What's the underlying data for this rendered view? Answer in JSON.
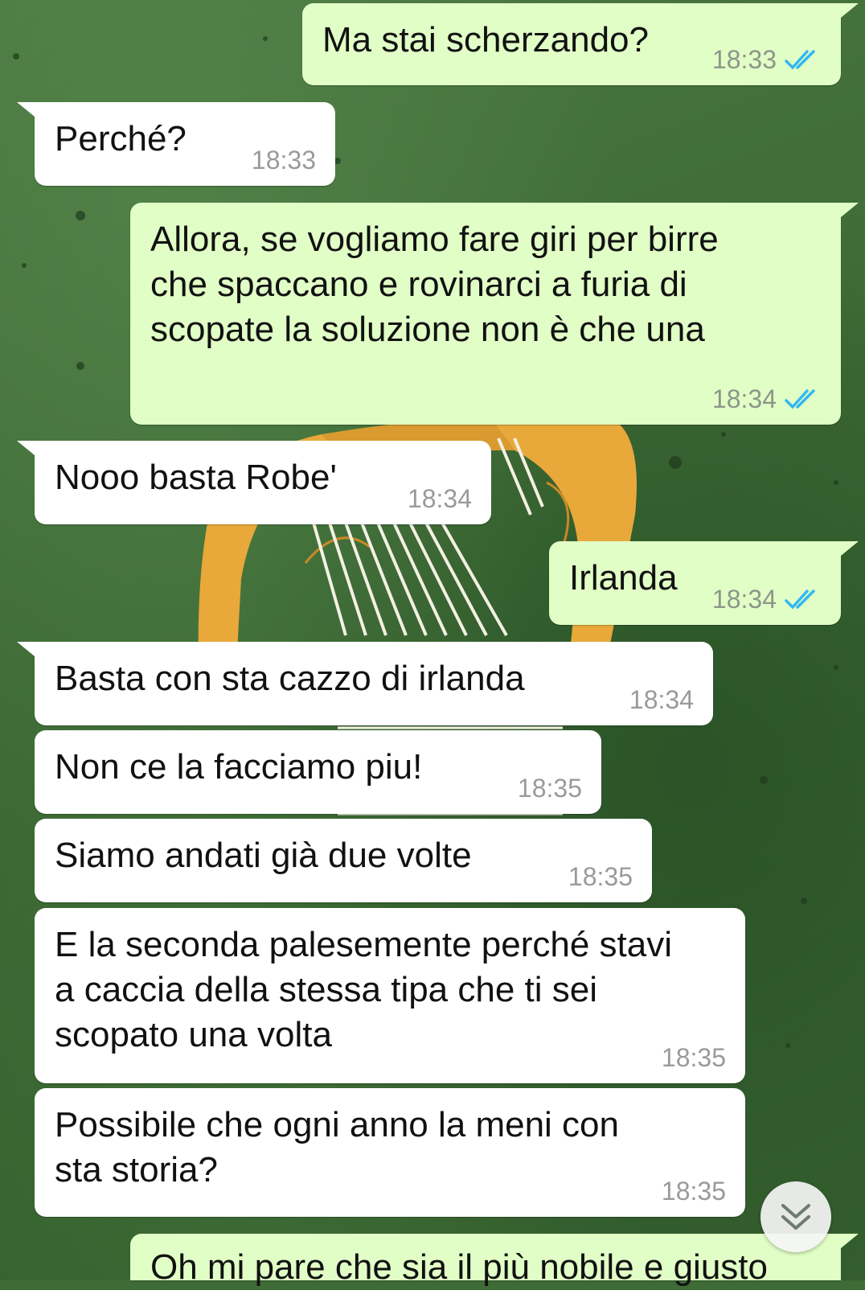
{
  "messages": [
    {
      "id": "m1",
      "direction": "out",
      "text": "Ma stai scherzando?",
      "time": "18:33",
      "status": "read"
    },
    {
      "id": "m2",
      "direction": "in",
      "text": "Perché?",
      "time": "18:33"
    },
    {
      "id": "m3",
      "direction": "out",
      "text": "Allora, se vogliamo fare giri per birre\nche spaccano e rovinarci a furia di\nscopate la soluzione non è che una",
      "time": "18:34",
      "status": "read"
    },
    {
      "id": "m4",
      "direction": "in",
      "text": "Nooo basta Robe'",
      "time": "18:34"
    },
    {
      "id": "m5",
      "direction": "out",
      "text": "Irlanda",
      "time": "18:34",
      "status": "read"
    },
    {
      "id": "m6",
      "direction": "in",
      "text": "Basta con sta cazzo di irlanda",
      "time": "18:34"
    },
    {
      "id": "m7",
      "direction": "in",
      "text": "Non ce la facciamo piu!",
      "time": "18:35"
    },
    {
      "id": "m8",
      "direction": "in",
      "text": "Siamo andati già due volte",
      "time": "18:35"
    },
    {
      "id": "m9",
      "direction": "in",
      "text": "E la seconda palesemente perché stavi\na caccia della stessa tipa che ti sei\nscopato una volta",
      "time": "18:35"
    },
    {
      "id": "m10",
      "direction": "in",
      "text": "Possibile che ogni anno la meni con\nsta storia?",
      "time": "18:35"
    },
    {
      "id": "m11",
      "direction": "out",
      "text": "Oh mi pare che sia il più nobile e giusto"
    }
  ],
  "icons": {
    "read_ticks": "double-check-icon",
    "scroll_down": "double-chevron-down-icon"
  },
  "colors": {
    "outgoing_bubble": "#e1fec6",
    "incoming_bubble": "#ffffff",
    "read_tick": "#34b7f1",
    "timestamp": "#8d9689",
    "wallpaper": "#3f6b37",
    "harp": "#e8a83a"
  }
}
